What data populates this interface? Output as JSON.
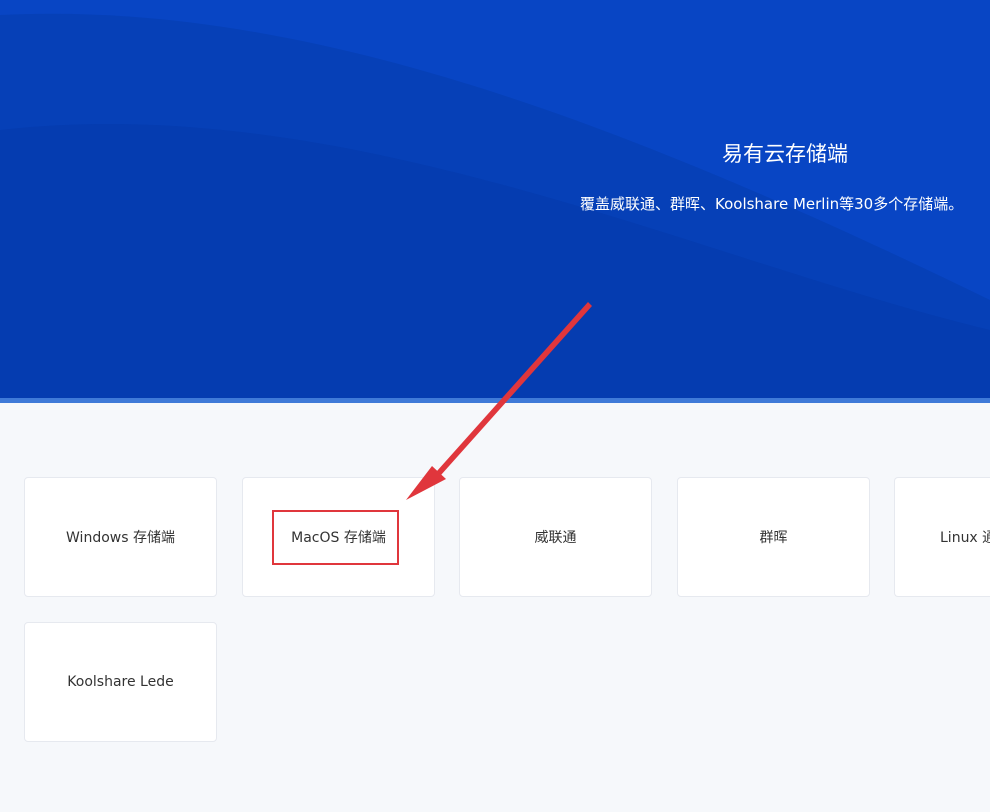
{
  "hero": {
    "title": "易有云存储端",
    "subtitle": "覆盖威联通、群晖、Koolshare Merlin等30多个存储端。"
  },
  "cards": [
    {
      "label": "Windows 存储端"
    },
    {
      "label": "MacOS 存储端"
    },
    {
      "label": "威联通"
    },
    {
      "label": "群晖"
    },
    {
      "label": "Linux 通"
    },
    {
      "label": "Koolshare Lede"
    }
  ],
  "colors": {
    "hero_bg": "#0845c4",
    "page_bg": "#f6f8fb",
    "annotation": "#e0363c"
  }
}
